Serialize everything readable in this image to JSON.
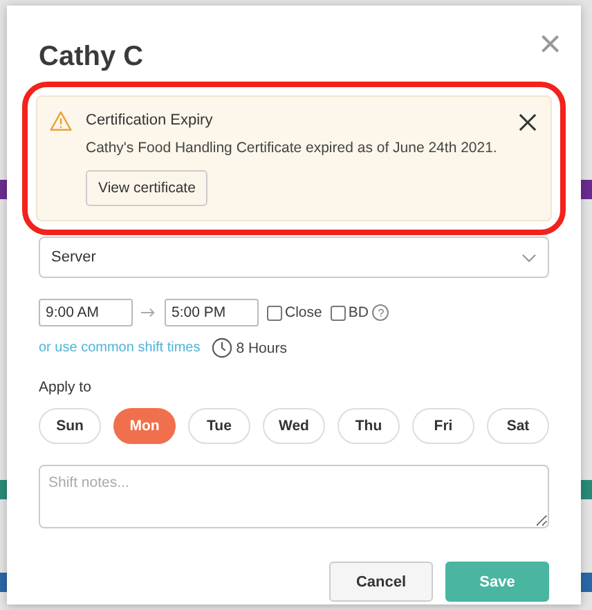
{
  "backdrop": {
    "bars": [
      {
        "color": "#6a2c91"
      },
      {
        "color": "#2a8a78"
      },
      {
        "color": "#2a67a8"
      }
    ]
  },
  "dialog": {
    "title": "Cathy C",
    "close": "×"
  },
  "alert": {
    "title": "Certification Expiry",
    "message": "Cathy's Food Handling Certificate expired as of June 24th 2021.",
    "button": "View certificate",
    "highlighted": true
  },
  "role": {
    "value": "Server"
  },
  "shift": {
    "start": "9:00 AM",
    "end": "5:00 PM",
    "close": {
      "label": "Close",
      "checked": false
    },
    "bd": {
      "label": "BD",
      "checked": false
    },
    "help": "?",
    "common_link": "or use common shift times",
    "duration": "8 Hours"
  },
  "apply_to": {
    "label": "Apply to",
    "days": [
      {
        "label": "Sun",
        "selected": false
      },
      {
        "label": "Mon",
        "selected": true
      },
      {
        "label": "Tue",
        "selected": false
      },
      {
        "label": "Wed",
        "selected": false
      },
      {
        "label": "Thu",
        "selected": false
      },
      {
        "label": "Fri",
        "selected": false
      },
      {
        "label": "Sat",
        "selected": false
      }
    ]
  },
  "notes": {
    "placeholder": "Shift notes..."
  },
  "buttons": [
    {
      "label": "Cancel",
      "kind": "secondary"
    },
    {
      "label": "Save",
      "kind": "primary"
    }
  ]
}
